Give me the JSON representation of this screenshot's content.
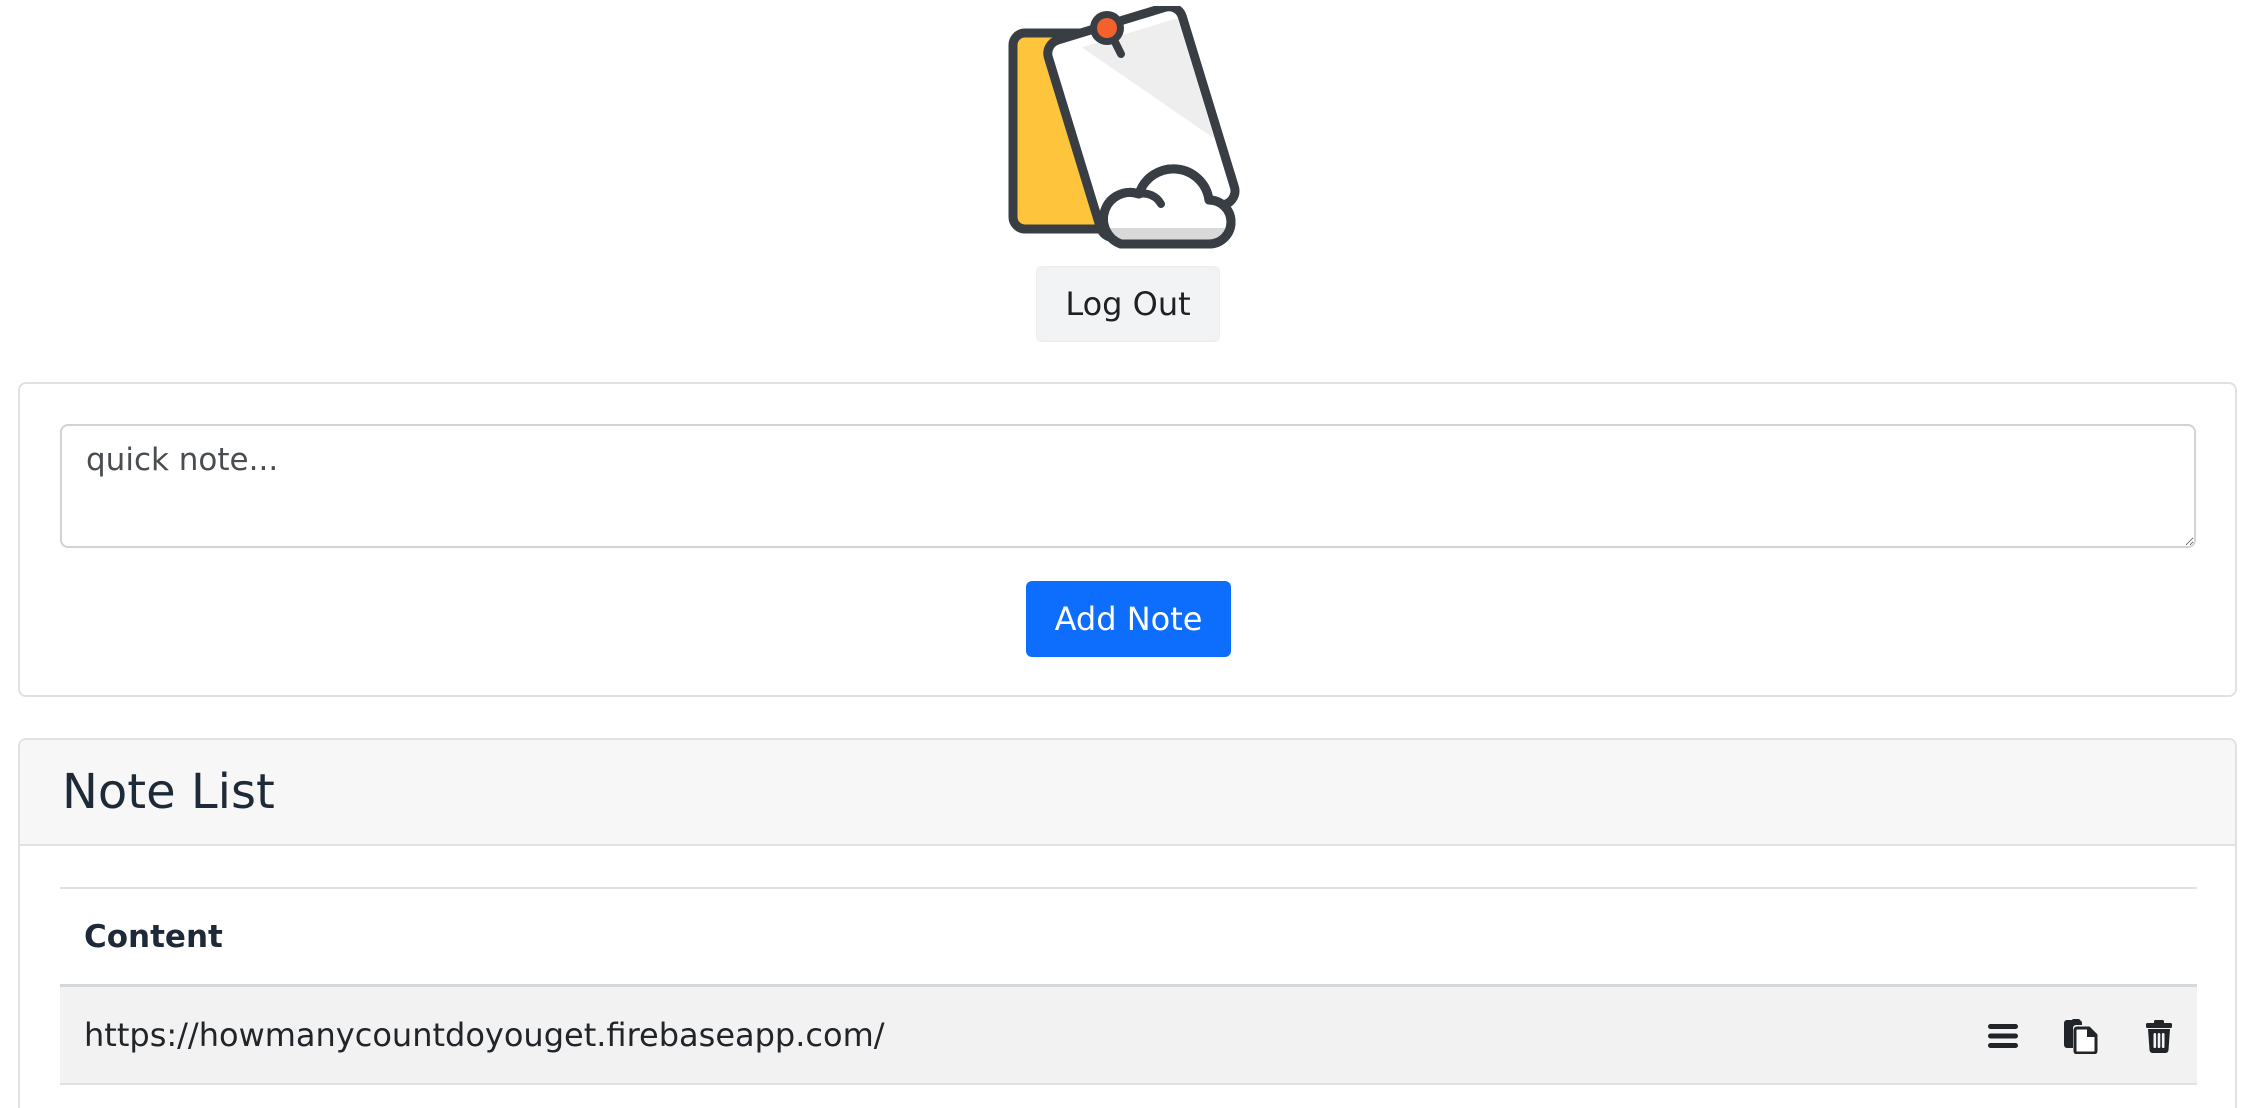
{
  "header": {
    "logo_icon": "sticky-note-cloud-icon",
    "logout_label": "Log Out"
  },
  "compose": {
    "placeholder": "quick note...",
    "add_label": "Add Note",
    "accent_color": "#0d6efd"
  },
  "note_list": {
    "title": "Note List",
    "columns": [
      "Content"
    ],
    "rows": [
      {
        "content": "https://howmanycountdoyouget.firebaseapp.com/",
        "actions": [
          "menu-icon",
          "copy-icon",
          "trash-icon"
        ]
      }
    ]
  }
}
